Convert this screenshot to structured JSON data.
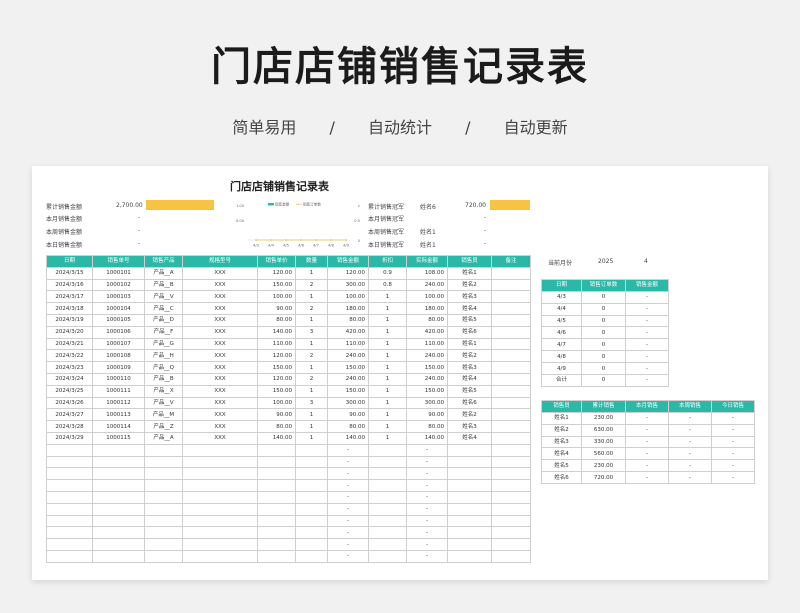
{
  "hero": {
    "title": "门店店铺销售记录表",
    "tags": [
      "简单易用",
      "/",
      "自动统计",
      "/",
      "自动更新"
    ]
  },
  "sheet_title": "门店店铺销售记录表",
  "left_stats": [
    {
      "label": "累计销售金额",
      "value": "2,700.00"
    },
    {
      "label": "本月销售金额",
      "value": "-"
    },
    {
      "label": "本周销售金额",
      "value": "-"
    },
    {
      "label": "本日销售金额",
      "value": "-"
    }
  ],
  "right_stats": [
    {
      "label": "累计销售冠军",
      "name": "姓名6",
      "value": "720.00"
    },
    {
      "label": "本月销售冠军",
      "name": "",
      "value": "-"
    },
    {
      "label": "本周销售冠军",
      "name": "姓名1",
      "value": "-"
    },
    {
      "label": "本日销售冠军",
      "name": "姓名1",
      "value": "-"
    }
  ],
  "chart_data": {
    "type": "bar",
    "title": "",
    "legend": [
      "销售金额",
      "销售订单数"
    ],
    "categories": [
      "4/3",
      "4/4",
      "4/5",
      "4/6",
      "4/7",
      "4/8",
      "4/9"
    ],
    "series": [
      {
        "name": "销售金额",
        "values": [
          0,
          0,
          0,
          0,
          0,
          0,
          0
        ]
      },
      {
        "name": "销售订单数",
        "values": [
          0,
          0,
          0,
          0,
          0,
          0,
          0
        ]
      }
    ],
    "left_ticks": [
      "1.00",
      "0.00"
    ],
    "right_ticks": [
      "1",
      "0.5",
      "0"
    ]
  },
  "main_table": {
    "headers": [
      "日期",
      "销售单号",
      "销售产品",
      "规格型号",
      "销售单价",
      "数量",
      "销售金额",
      "折扣",
      "实际金额",
      "销售员",
      "备注"
    ],
    "rows": [
      [
        "2024/3/15",
        "1000101",
        "产品__A",
        "XXX",
        "120.00",
        "1",
        "120.00",
        "0.9",
        "108.00",
        "姓名1",
        ""
      ],
      [
        "2024/3/16",
        "1000102",
        "产品__B",
        "XXX",
        "150.00",
        "2",
        "300.00",
        "0.8",
        "240.00",
        "姓名2",
        ""
      ],
      [
        "2024/3/17",
        "1000103",
        "产品__V",
        "XXX",
        "100.00",
        "1",
        "100.00",
        "1",
        "100.00",
        "姓名3",
        ""
      ],
      [
        "2024/3/18",
        "1000104",
        "产品__C",
        "XXX",
        "90.00",
        "2",
        "180.00",
        "1",
        "180.00",
        "姓名4",
        ""
      ],
      [
        "2024/3/19",
        "1000105",
        "产品__D",
        "XXX",
        "80.00",
        "1",
        "80.00",
        "1",
        "80.00",
        "姓名5",
        ""
      ],
      [
        "2024/3/20",
        "1000106",
        "产品__F",
        "XXX",
        "140.00",
        "3",
        "420.00",
        "1",
        "420.00",
        "姓名6",
        ""
      ],
      [
        "2024/3/21",
        "1000107",
        "产品__G",
        "XXX",
        "110.00",
        "1",
        "110.00",
        "1",
        "110.00",
        "姓名1",
        ""
      ],
      [
        "2024/3/22",
        "1000108",
        "产品__H",
        "XXX",
        "120.00",
        "2",
        "240.00",
        "1",
        "240.00",
        "姓名2",
        ""
      ],
      [
        "2024/3/23",
        "1000109",
        "产品__Q",
        "XXX",
        "150.00",
        "1",
        "150.00",
        "1",
        "150.00",
        "姓名3",
        ""
      ],
      [
        "2024/3/24",
        "1000110",
        "产品__B",
        "XXX",
        "120.00",
        "2",
        "240.00",
        "1",
        "240.00",
        "姓名4",
        ""
      ],
      [
        "2024/3/25",
        "1000111",
        "产品__X",
        "XXX",
        "150.00",
        "1",
        "150.00",
        "1",
        "150.00",
        "姓名5",
        ""
      ],
      [
        "2024/3/26",
        "1000112",
        "产品__V",
        "XXX",
        "100.00",
        "3",
        "300.00",
        "1",
        "300.00",
        "姓名6",
        ""
      ],
      [
        "2024/3/27",
        "1000113",
        "产品__M",
        "XXX",
        "90.00",
        "1",
        "90.00",
        "1",
        "90.00",
        "姓名2",
        ""
      ],
      [
        "2024/3/28",
        "1000114",
        "产品__Z",
        "XXX",
        "80.00",
        "1",
        "80.00",
        "1",
        "80.00",
        "姓名3",
        ""
      ],
      [
        "2024/3/29",
        "1000115",
        "产品__A",
        "XXX",
        "140.00",
        "1",
        "140.00",
        "1",
        "140.00",
        "姓名4",
        ""
      ],
      [
        "",
        "",
        "",
        "",
        "",
        "",
        "-",
        "",
        "-",
        "",
        ""
      ],
      [
        "",
        "",
        "",
        "",
        "",
        "",
        "-",
        "",
        "-",
        "",
        ""
      ],
      [
        "",
        "",
        "",
        "",
        "",
        "",
        "-",
        "",
        "-",
        "",
        ""
      ],
      [
        "",
        "",
        "",
        "",
        "",
        "",
        "-",
        "",
        "-",
        "",
        ""
      ],
      [
        "",
        "",
        "",
        "",
        "",
        "",
        "-",
        "",
        "-",
        "",
        ""
      ],
      [
        "",
        "",
        "",
        "",
        "",
        "",
        "-",
        "",
        "-",
        "",
        ""
      ],
      [
        "",
        "",
        "",
        "",
        "",
        "",
        "-",
        "",
        "-",
        "",
        ""
      ],
      [
        "",
        "",
        "",
        "",
        "",
        "",
        "-",
        "",
        "-",
        "",
        ""
      ],
      [
        "",
        "",
        "",
        "",
        "",
        "",
        "-",
        "",
        "-",
        "",
        ""
      ],
      [
        "",
        "",
        "",
        "",
        "",
        "",
        "-",
        "",
        "-",
        "",
        ""
      ]
    ]
  },
  "current_month": {
    "label": "当前月份",
    "year": "2025",
    "month": "4"
  },
  "daily_table": {
    "headers": [
      "日期",
      "销售订单数",
      "销售金额"
    ],
    "rows": [
      [
        "4/3",
        "0",
        "-"
      ],
      [
        "4/4",
        "0",
        "-"
      ],
      [
        "4/5",
        "0",
        "-"
      ],
      [
        "4/6",
        "0",
        "-"
      ],
      [
        "4/7",
        "0",
        "-"
      ],
      [
        "4/8",
        "0",
        "-"
      ],
      [
        "4/9",
        "0",
        "-"
      ],
      [
        "合计",
        "0",
        "-"
      ]
    ]
  },
  "staff_table": {
    "headers": [
      "销售员",
      "累计销售",
      "本月销售",
      "本周销售",
      "今日销售"
    ],
    "rows": [
      [
        "姓名1",
        "230.00",
        "-",
        "-",
        "-"
      ],
      [
        "姓名2",
        "630.00",
        "-",
        "-",
        "-"
      ],
      [
        "姓名3",
        "330.00",
        "-",
        "-",
        "-"
      ],
      [
        "姓名4",
        "560.00",
        "-",
        "-",
        "-"
      ],
      [
        "姓名5",
        "230.00",
        "-",
        "-",
        "-"
      ],
      [
        "姓名6",
        "720.00",
        "-",
        "-",
        "-"
      ]
    ]
  },
  "colors": {
    "header": "#2bb8a6",
    "bar": "#f6c344",
    "line": "#e8c15a"
  }
}
